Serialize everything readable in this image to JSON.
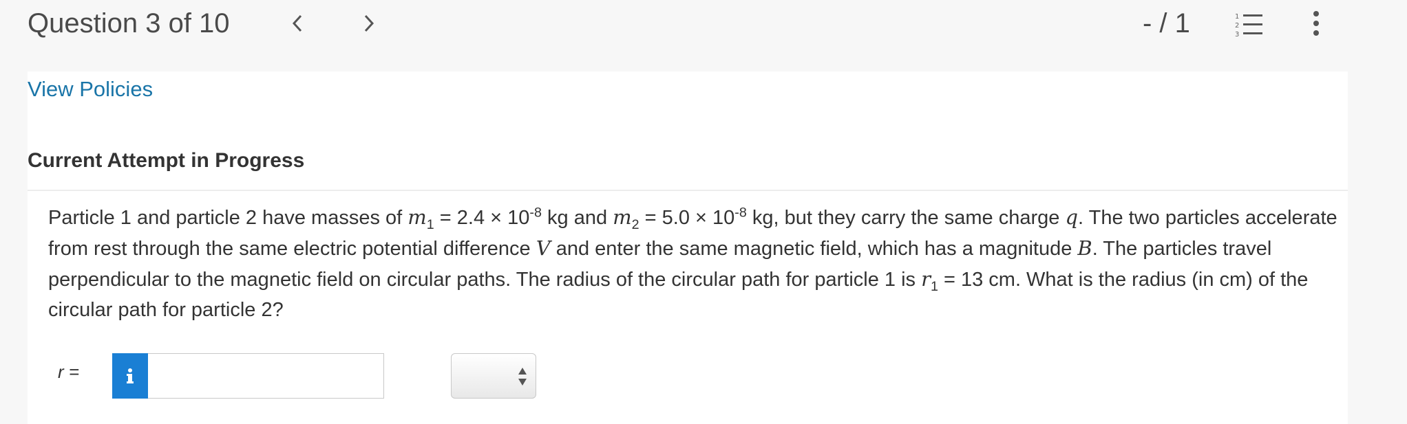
{
  "header": {
    "question_counter": "Question 3 of 10",
    "score": "- / 1",
    "prev_icon": "chevron-left-icon",
    "next_icon": "chevron-right-icon",
    "list_icon": "numbered-list-icon",
    "more_icon": "more-vertical-icon"
  },
  "content": {
    "policies_link": "View Policies",
    "attempt_heading": "Current Attempt in Progress",
    "question": {
      "p1": "Particle 1 and particle 2 have masses of ",
      "m1": "m",
      "m1_sub": "1",
      "eq1": " = 2.4 × 10",
      "exp1": "-8",
      "p2": " kg and ",
      "m2": "m",
      "m2_sub": "2",
      "eq2": " = 5.0 × 10",
      "exp2": "-8",
      "p3": " kg, but they carry the same charge ",
      "q": "q",
      "p4": ". The two particles accelerate from rest through the same electric potential difference ",
      "V": "V",
      "p5": " and enter the same magnetic field, which has a magnitude ",
      "B": "B",
      "p6": ". The particles travel perpendicular to the magnetic field on circular paths. The radius of the circular path for particle 1 is ",
      "r1": "r",
      "r1_sub": "1",
      "p7": " = 13 cm. What is the radius (in cm) of the circular path for particle 2?"
    },
    "answer": {
      "label": "r =",
      "info_glyph": "i",
      "value": "",
      "unit_selected": ""
    }
  },
  "colors": {
    "link": "#1a75a8",
    "info_button": "#1a7fd4",
    "background": "#f7f7f7"
  }
}
